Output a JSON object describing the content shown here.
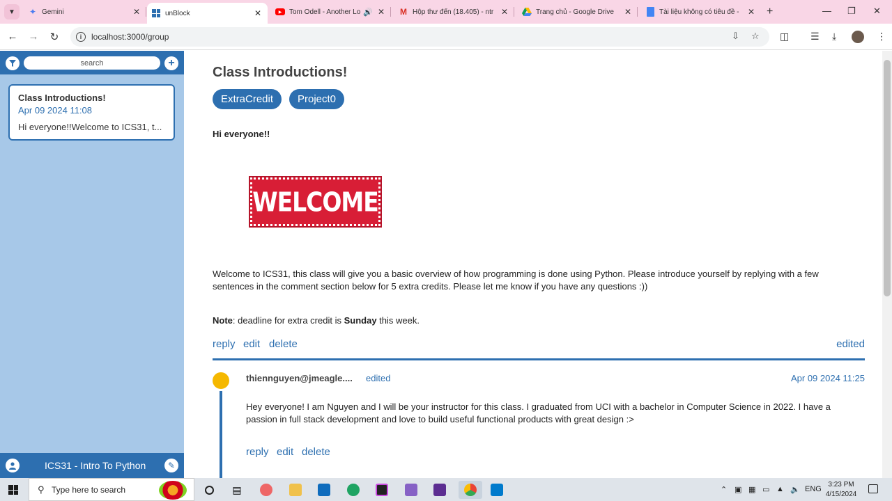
{
  "browser": {
    "tabs": [
      {
        "title": "Gemini",
        "icon": "gemini-icon",
        "active": false
      },
      {
        "title": "unBlock",
        "icon": "unblock-icon",
        "active": true
      },
      {
        "title": "Tom Odell - Another Lo",
        "icon": "youtube-icon",
        "active": false
      },
      {
        "title": "Hộp thư đến (18.405) - ntr",
        "icon": "gmail-icon",
        "active": false
      },
      {
        "title": "Trang chủ - Google Drive",
        "icon": "drive-icon",
        "active": false
      },
      {
        "title": "Tài liệu không có tiêu đề -",
        "icon": "docs-icon",
        "active": false
      }
    ],
    "url": "localhost:3000/group"
  },
  "sidebar": {
    "search_placeholder": "search",
    "posts": [
      {
        "title": "Class Introductions!",
        "date": "Apr 09 2024 11:08",
        "preview": "Hi everyone!!Welcome to ICS31, t..."
      }
    ],
    "group_name": "ICS31 - Intro To Python"
  },
  "post": {
    "title": "Class Introductions!",
    "tags": [
      "ExtraCredit",
      "Project0"
    ],
    "greeting": "Hi everyone!!",
    "image_text": "WELCOME",
    "body": "Welcome to ICS31, this class will give you a basic overview of how programming is done using Python. Please introduce yourself by replying with a few sentences in the comment section below for 5 extra credits. Please let me know if you have any questions :))",
    "note": {
      "label": "Note",
      "text_before": ": deadline for extra credit is ",
      "emphasis": "Sunday",
      "text_after": " this week."
    },
    "actions": {
      "reply": "reply",
      "edit": "edit",
      "delete": "delete",
      "edited": "edited"
    }
  },
  "comment": {
    "author": "thiennguyen@jmeagle....",
    "edited": "edited",
    "date": "Apr 09 2024 11:25",
    "body": "Hey everyone! I am Nguyen and I will be your instructor for this class. I graduated from UCI with a bachelor in Computer Science in 2022. I have a passion in full stack development and love to build useful functional products with great design :>",
    "actions": {
      "reply": "reply",
      "edit": "edit",
      "delete": "delete"
    },
    "avatar_color": "#f5b800"
  },
  "taskbar": {
    "search_text": "Type here to search",
    "language": "ENG",
    "time": "3:23 PM",
    "date": "4/15/2024"
  },
  "colors": {
    "accent": "#2d6fb0",
    "sidebar_bg": "#a7c8e8",
    "tab_strip": "#f9d6e6"
  }
}
